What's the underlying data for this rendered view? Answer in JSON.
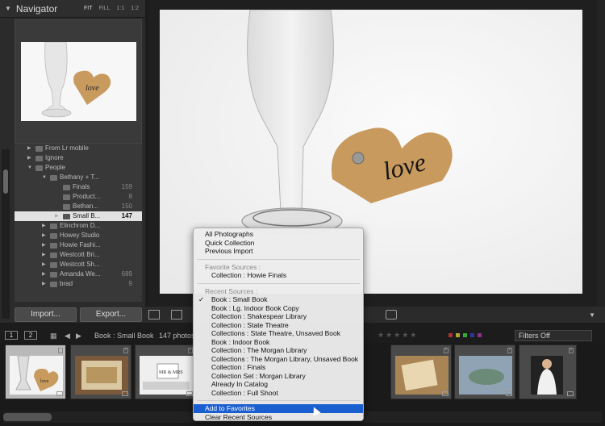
{
  "navigator": {
    "title": "Navigator",
    "options": [
      "FIT",
      "FILL",
      "1:1",
      "1:2"
    ]
  },
  "tree": [
    {
      "label": "From Lr mobile",
      "count": "",
      "level": 1
    },
    {
      "label": "Ignore",
      "count": "",
      "level": 1
    },
    {
      "label": "People",
      "count": "",
      "level": 1
    },
    {
      "label": "Bethany + T...",
      "count": "",
      "level": 2
    },
    {
      "label": "Finals",
      "count": "159",
      "level": 3
    },
    {
      "label": "Product...",
      "count": "8",
      "level": 3
    },
    {
      "label": "Bethan...",
      "count": "150",
      "level": 3
    },
    {
      "label": "Small B...",
      "count": "147",
      "level": 3,
      "selected": true
    },
    {
      "label": "Elinchrom D...",
      "count": "",
      "level": 2
    },
    {
      "label": "Howey Studio",
      "count": "",
      "level": 2
    },
    {
      "label": "Howie Fashi...",
      "count": "",
      "level": 2
    },
    {
      "label": "Westcott Bri...",
      "count": "",
      "level": 2
    },
    {
      "label": "Westcott Sh...",
      "count": "",
      "level": 2
    },
    {
      "label": "Amanda We...",
      "count": "689",
      "level": 2
    },
    {
      "label": "brad",
      "count": "9",
      "level": 2
    }
  ],
  "left_buttons": {
    "import": "Import...",
    "export": "Export..."
  },
  "photo": {
    "text": "love"
  },
  "filmbar": {
    "view1": "1",
    "view2": "2",
    "source": "Book : Small Book",
    "count": "147 photos",
    "filters": "Filters Off"
  },
  "menu": {
    "items": [
      {
        "label": "All Photographs",
        "type": "item"
      },
      {
        "label": "Quick Collection",
        "type": "item"
      },
      {
        "label": "Previous Import",
        "type": "item"
      },
      {
        "type": "sep"
      },
      {
        "label": "Favorite Sources :",
        "type": "hdr"
      },
      {
        "label": "Collection : Howie Finals",
        "type": "indent"
      },
      {
        "type": "sep"
      },
      {
        "label": "Recent Sources :",
        "type": "hdr"
      },
      {
        "label": "Book : Small Book",
        "type": "indent",
        "checked": true
      },
      {
        "label": "Book : Lg. Indoor Book Copy",
        "type": "indent"
      },
      {
        "label": "Collection : Shakespear Library",
        "type": "indent"
      },
      {
        "label": "Collection : State Theatre",
        "type": "indent"
      },
      {
        "label": "Collections : State Theatre, Unsaved Book",
        "type": "indent"
      },
      {
        "label": "Book : Indoor Book",
        "type": "indent"
      },
      {
        "label": "Collection : The Morgan Library",
        "type": "indent"
      },
      {
        "label": "Collections : The Morgan Library, Unsaved Book",
        "type": "indent"
      },
      {
        "label": "Collection : Finals",
        "type": "indent"
      },
      {
        "label": "Collection Set : Morgan Library",
        "type": "indent"
      },
      {
        "label": "Already In Catalog",
        "type": "indent"
      },
      {
        "label": "Collection : Full Shoot",
        "type": "indent"
      },
      {
        "type": "sep"
      },
      {
        "label": "Add to Favorites",
        "type": "item",
        "highlighted": true
      },
      {
        "label": "Clear Recent Sources",
        "type": "item"
      }
    ]
  },
  "filmstrip": {
    "thumb1_text": "love",
    "thumb3_text": "MR & MRS"
  },
  "colors": {
    "highlight": "#1a5fd0",
    "cork": "#c89a5e"
  }
}
